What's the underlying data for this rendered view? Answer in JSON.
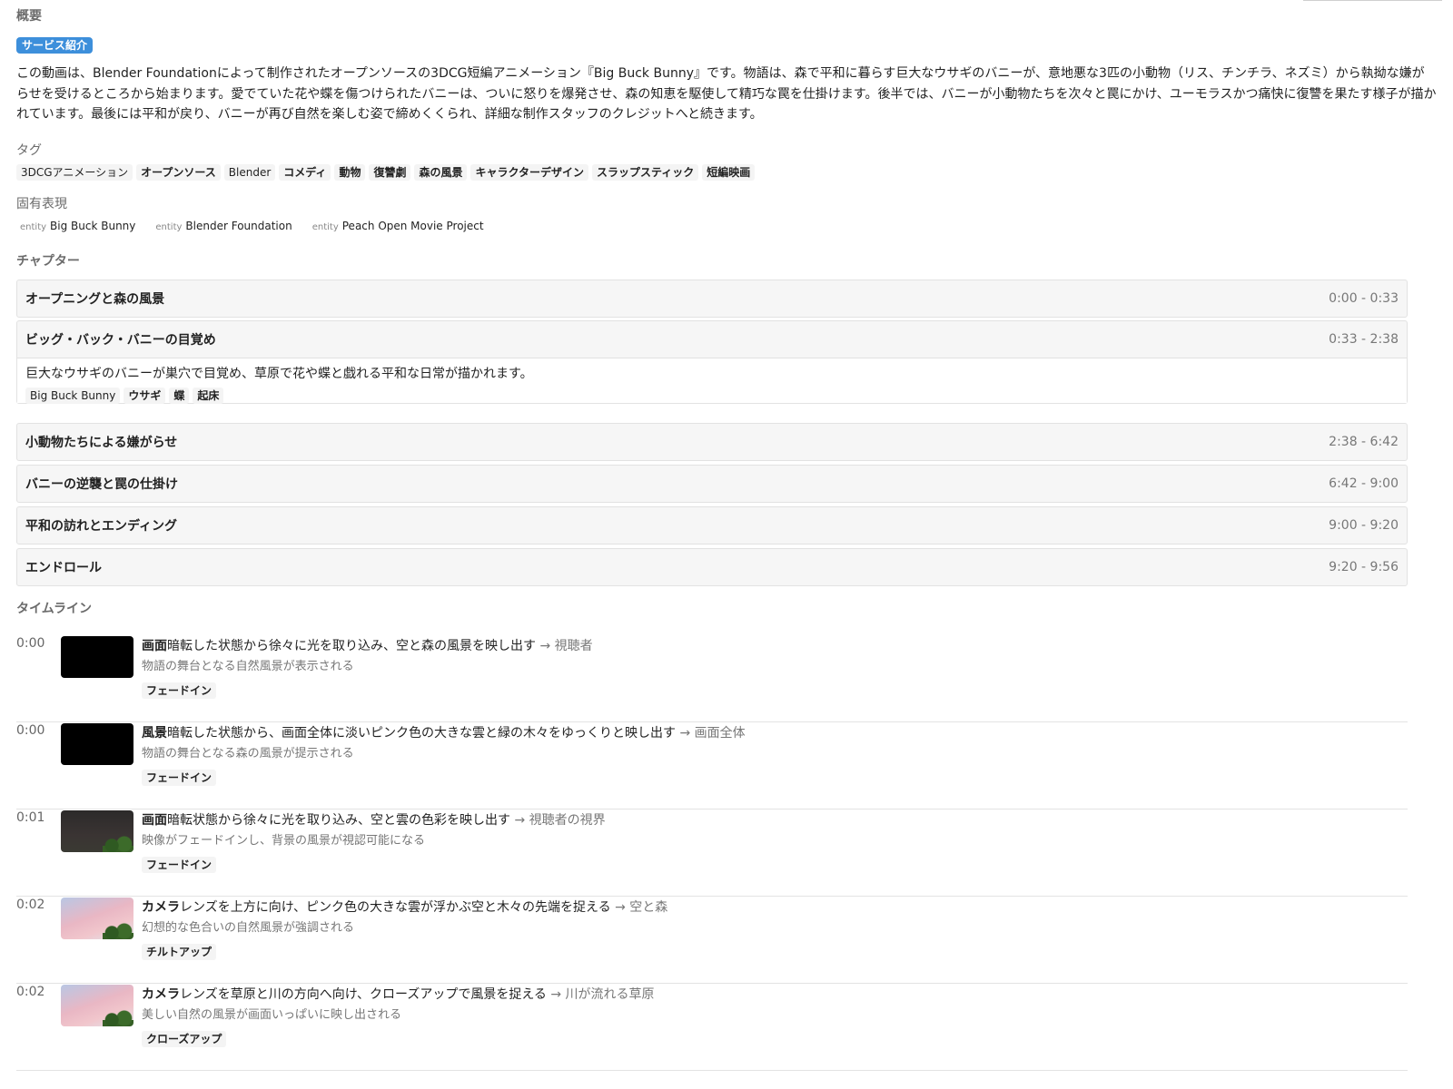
{
  "overview": {
    "label": "概要",
    "badge": "サービス紹介",
    "summary": "この動画は、Blender Foundationによって制作されたオープンソースの3DCG短編アニメーション『Big Buck Bunny』です。物語は、森で平和に暮らす巨大なウサギのバニーが、意地悪な3匹の小動物（リス、チンチラ、ネズミ）から執拗な嫌がらせを受けるところから始まります。愛でていた花や蝶を傷つけられたバニーは、ついに怒りを爆発させ、森の知恵を駆使して精巧な罠を仕掛けます。後半では、バニーが小動物たちを次々と罠にかけ、ユーモラスかつ痛快に復讐を果たす様子が描かれています。最後には平和が戻り、バニーが再び自然を楽しむ姿で締めくくられ、詳細な制作スタッフのクレジットへと続きます。"
  },
  "tags": {
    "label": "タグ",
    "items": [
      "3DCGアニメーション",
      "オープンソース",
      "Blender",
      "コメディ",
      "動物",
      "復讐劇",
      "森の風景",
      "キャラクターデザイン",
      "スラップスティック",
      "短編映画"
    ]
  },
  "entities": {
    "label": "固有表現",
    "kind_label": "entity",
    "items": [
      "Big Buck Bunny",
      "Blender Foundation",
      "Peach Open Movie Project"
    ]
  },
  "chapters": {
    "label": "チャプター",
    "items": [
      {
        "title": "オープニングと森の風景",
        "time": "0:00 - 0:33"
      },
      {
        "title": "ビッグ・バック・バニーの目覚め",
        "time": "0:33 - 2:38",
        "desc": "巨大なウサギのバニーが巣穴で目覚め、草原で花や蝶と戯れる平和な日常が描かれます。",
        "tags": [
          "Big Buck Bunny",
          "ウサギ",
          "蝶",
          "起床"
        ]
      },
      {
        "title": "小動物たちによる嫌がらせ",
        "time": "2:38 - 6:42"
      },
      {
        "title": "バニーの逆襲と罠の仕掛け",
        "time": "6:42 - 9:00"
      },
      {
        "title": "平和の訪れとエンディング",
        "time": "9:00 - 9:20"
      },
      {
        "title": "エンドロール",
        "time": "9:20 - 9:56"
      }
    ]
  },
  "timeline": {
    "label": "タイムライン",
    "items": [
      {
        "time": "0:00",
        "subject": "画面",
        "action": "暗転した状態から徐々に光を取り込み、空と森の風景を映し出す",
        "target": "→ 視聴者",
        "note": "物語の舞台となる自然風景が表示される",
        "technique": "フェードイン",
        "thumb": "black"
      },
      {
        "time": "0:00",
        "subject": "風景",
        "action": "暗転した状態から、画面全体に淡いピンク色の大きな雲と緑の木々をゆっくりと映し出す",
        "target": "→ 画面全体",
        "note": "物語の舞台となる森の風景が提示される",
        "technique": "フェードイン",
        "thumb": "black"
      },
      {
        "time": "0:01",
        "subject": "画面",
        "action": "暗転状態から徐々に光を取り込み、空と雲の色彩を映し出す",
        "target": "→ 視聴者の視界",
        "note": "映像がフェードインし、背景の風景が視認可能になる",
        "technique": "フェードイン",
        "thumb": "dark"
      },
      {
        "time": "0:02",
        "subject": "カメラ",
        "action": "レンズを上方に向け、ピンク色の大きな雲が浮かぶ空と木々の先端を捉える",
        "target": "→ 空と森",
        "note": "幻想的な色合いの自然風景が強調される",
        "technique": "チルトアップ",
        "thumb": "pink"
      },
      {
        "time": "0:02",
        "subject": "カメラ",
        "action": "レンズを草原と川の方向へ向け、クローズアップで風景を捉える",
        "target": "→ 川が流れる草原",
        "note": "美しい自然の風景が画面いっぱいに映し出される",
        "technique": "クローズアップ",
        "thumb": "pink"
      }
    ]
  }
}
